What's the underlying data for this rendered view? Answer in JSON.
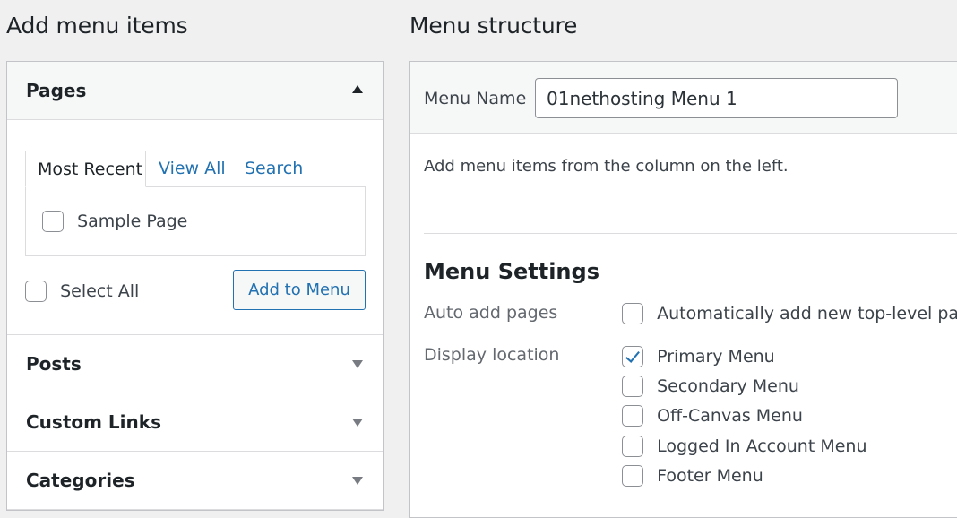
{
  "left": {
    "heading": "Add menu items",
    "pages": {
      "title": "Pages",
      "tabs": [
        "Most Recent",
        "View All",
        "Search"
      ],
      "items": [
        "Sample Page"
      ],
      "select_all": "Select All",
      "add_button": "Add to Menu"
    },
    "sections": [
      "Posts",
      "Custom Links",
      "Categories"
    ]
  },
  "right": {
    "heading": "Menu structure",
    "menu_name_label": "Menu Name",
    "menu_name_value": "01nethosting Menu 1",
    "info": "Add menu items from the column on the left.",
    "settings": {
      "title": "Menu Settings",
      "auto_add_label": "Auto add pages",
      "auto_add_option": "Automatically add new top-level pages",
      "display_location_label": "Display location",
      "locations": [
        {
          "label": "Primary Menu",
          "checked": true
        },
        {
          "label": "Secondary Menu",
          "checked": false
        },
        {
          "label": "Off-Canvas Menu",
          "checked": false
        },
        {
          "label": "Logged In Account Menu",
          "checked": false
        },
        {
          "label": "Footer Menu",
          "checked": false
        }
      ]
    }
  },
  "colors": {
    "accent": "#2271b1",
    "background": "#f0f0f1",
    "border": "#c3c4c7"
  },
  "icons": {
    "open_section": "arrow-up-icon",
    "closed_section": "arrow-down-icon",
    "checked": "checkmark-icon"
  }
}
